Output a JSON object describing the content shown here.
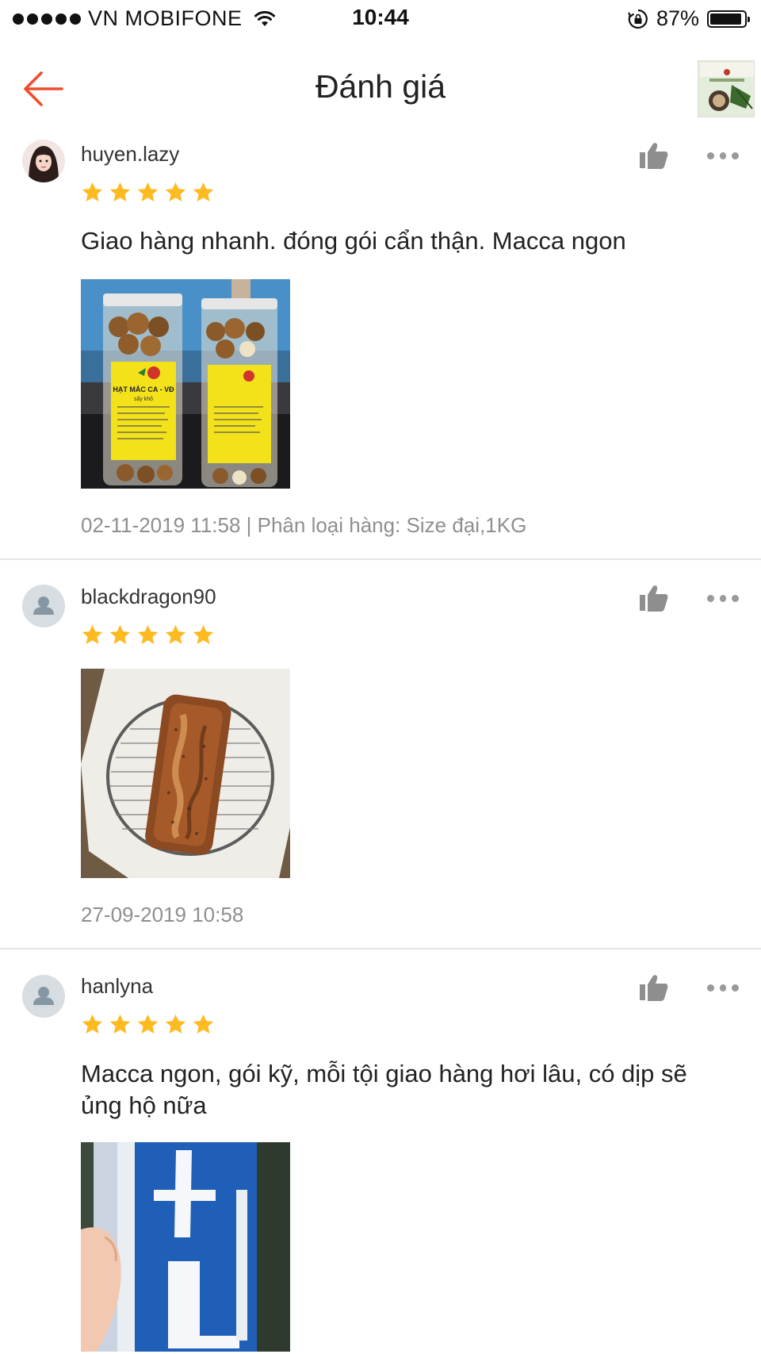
{
  "status_bar": {
    "carrier": "VN MOBIFONE",
    "time": "10:44",
    "battery_percent": "87%",
    "battery_level": 0.87
  },
  "header": {
    "title": "Đánh giá",
    "back_icon": "arrow-left-icon",
    "accent_color": "#ee4d2d"
  },
  "star_color": "#fdba21",
  "reviews": [
    {
      "username": "huyen.lazy",
      "rating": 5,
      "text": "Giao hàng nhanh. đóng gói cẩn thận. Macca ngon",
      "meta": "02-11-2019 11:58 | Phân loại hàng: Size đại,1KG"
    },
    {
      "username": "blackdragon90",
      "rating": 5,
      "text": "",
      "meta": "27-09-2019 10:58"
    },
    {
      "username": "hanlyna",
      "rating": 5,
      "text": "Macca ngon, gói kỹ,  mỗi tội giao hàng hơi lâu, có dịp sẽ ủng hộ nữa",
      "meta": ""
    }
  ],
  "photo_labels": {
    "jar_label": "HẠT MẮC CA - VĐ",
    "jar_sub": "sấy khô"
  }
}
